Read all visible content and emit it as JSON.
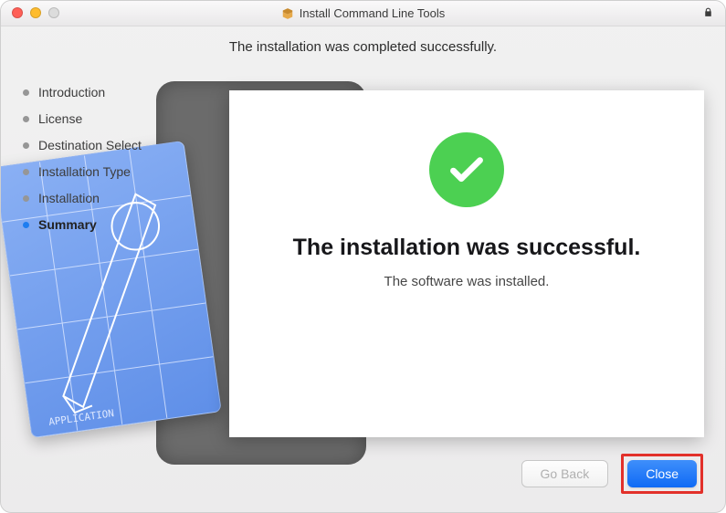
{
  "window": {
    "title": "Install Command Line Tools"
  },
  "headline": "The installation was completed successfully.",
  "sidebar": {
    "steps": {
      "0": {
        "label": "Introduction"
      },
      "1": {
        "label": "License"
      },
      "2": {
        "label": "Destination Select"
      },
      "3": {
        "label": "Installation Type"
      },
      "4": {
        "label": "Installation"
      },
      "5": {
        "label": "Summary"
      }
    },
    "active_index": 5
  },
  "panel": {
    "title": "The installation was successful.",
    "subtitle": "The software was installed."
  },
  "footer": {
    "back": "Go Back",
    "close": "Close"
  }
}
